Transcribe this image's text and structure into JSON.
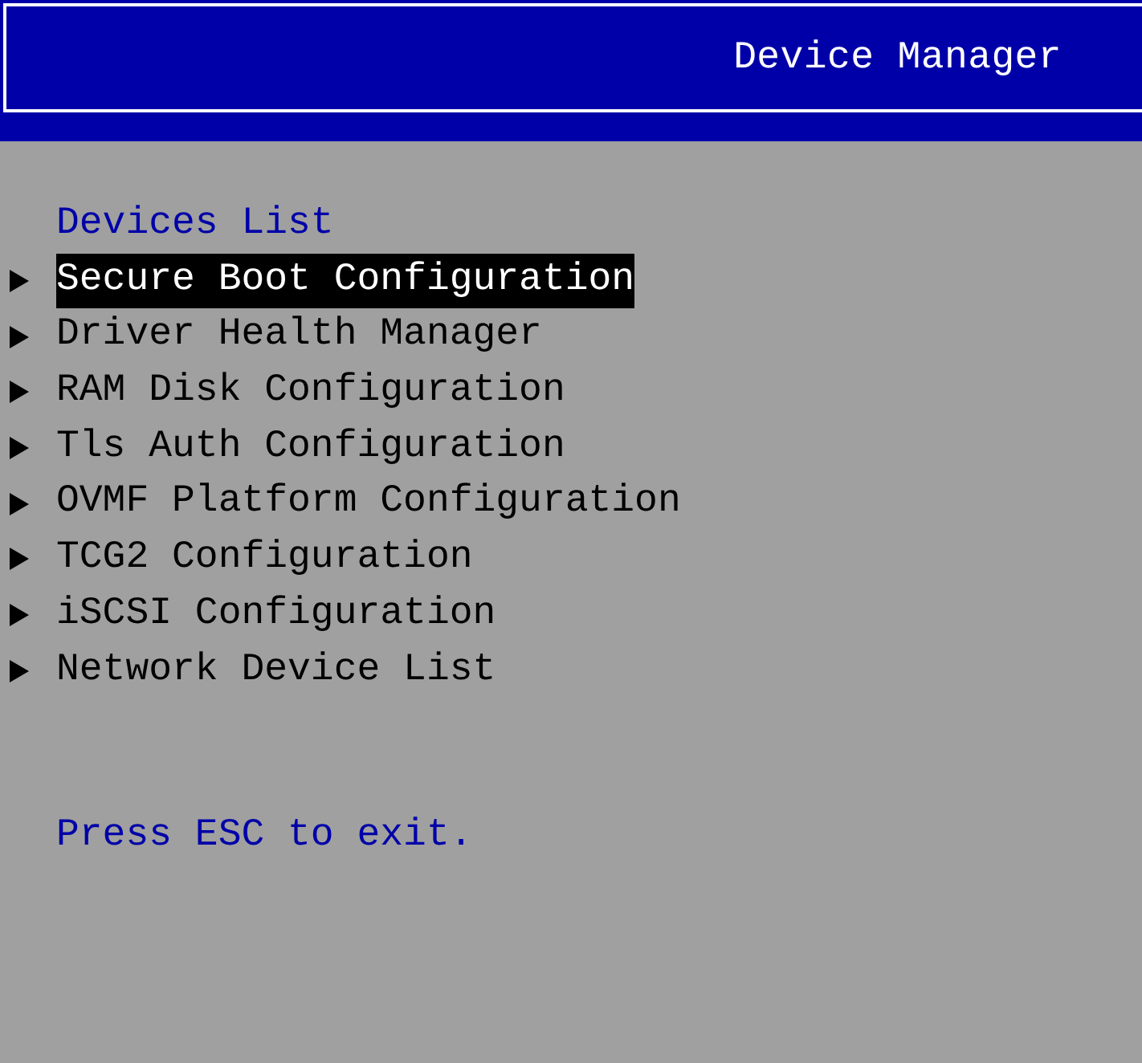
{
  "window": {
    "title": "Device Manager"
  },
  "devices": {
    "heading": "Devices List",
    "items": [
      {
        "label": "Secure Boot Configuration",
        "selected": true
      },
      {
        "label": "Driver Health Manager",
        "selected": false
      },
      {
        "label": "RAM Disk Configuration",
        "selected": false
      },
      {
        "label": "Tls Auth Configuration",
        "selected": false
      },
      {
        "label": "OVMF Platform Configuration",
        "selected": false
      },
      {
        "label": "TCG2 Configuration",
        "selected": false
      },
      {
        "label": "iSCSI Configuration",
        "selected": false
      },
      {
        "label": "Network Device List",
        "selected": false
      }
    ]
  },
  "help_text": "Press ESC to exit."
}
